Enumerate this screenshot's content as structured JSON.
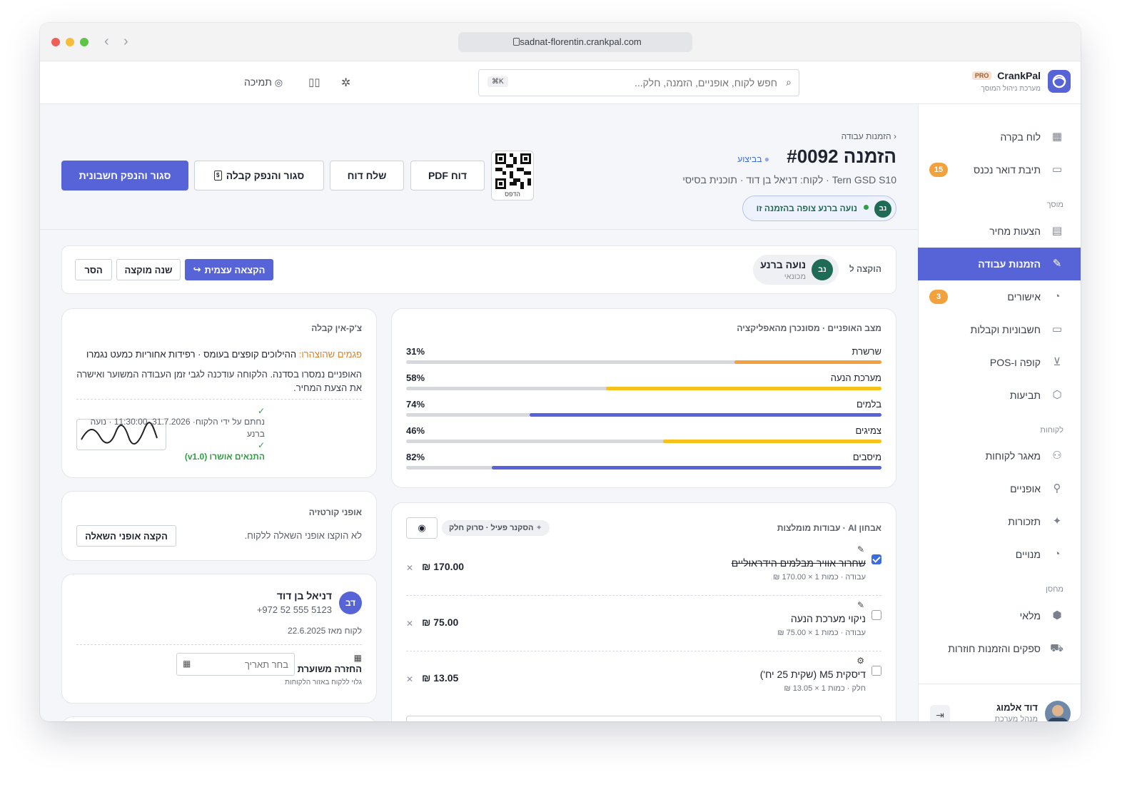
{
  "browser": {
    "url": "sadnat-florentin.crankpal.com"
  },
  "colors": {
    "accent": "#5664d8",
    "orange": "#f2a23d",
    "yellow": "#f5c11a",
    "green": "#2f9e44",
    "avatar_green": "#1f6b55"
  },
  "topbar": {
    "search_placeholder": "חפש לקוח, אופניים, הזמנה, חלק...",
    "search_shortcut": "⌘K",
    "support_label": "תמיכה"
  },
  "brand": {
    "name": "CrankPal",
    "tag": "PRO",
    "subtitle": "מערכת ניהול המוסך"
  },
  "sidebar": {
    "items": [
      {
        "label": "לוח בקרה",
        "icon": "grid-icon"
      },
      {
        "label": "תיבת דואר נכנס",
        "icon": "inbox-icon",
        "badge": "15"
      },
      {
        "label": "הצעות מחיר",
        "icon": "document-icon"
      },
      {
        "label": "הזמנות עבודה",
        "icon": "wrench-icon"
      },
      {
        "label": "אישורים",
        "icon": "check-circle-icon",
        "badge": "3"
      },
      {
        "label": "חשבוניות וקבלות",
        "icon": "money-icon"
      },
      {
        "label": "קופה ו-POS",
        "icon": "cart-icon"
      },
      {
        "label": "תביעות",
        "icon": "shield-icon"
      },
      {
        "label": "מאגר לקוחות",
        "icon": "users-icon"
      },
      {
        "label": "אופניים",
        "icon": "bike-icon"
      },
      {
        "label": "תזכורות",
        "icon": "sparkle-icon"
      },
      {
        "label": "מנויים",
        "icon": "check-circle-icon"
      },
      {
        "label": "מלאי",
        "icon": "box-icon"
      },
      {
        "label": "ספקים והזמנות חוזרות",
        "icon": "truck-icon"
      }
    ],
    "sections": [
      "מוסך",
      "לקוחות",
      "מחסן"
    ],
    "user": {
      "name": "דוד אלמוג",
      "role": "מנהל מערכת"
    }
  },
  "header": {
    "breadcrumb": "הזמנות עבודה",
    "title": "הזמנה #0092",
    "status": "בביצוע",
    "subtitle": "Tern GSD S10 · לקוח: דניאל בן דוד · תוכנית בסיסי",
    "presence_initials": "נב",
    "presence_text": "נועה ברנע צופה בהזמנה זו",
    "qr_label": "הדפס",
    "buttons": {
      "pdf": "דוח PDF",
      "send_report": "שלח דוח",
      "close_receipt": "סגור והנפק קבלה",
      "close_invoice": "סגור והנפק חשבונית"
    }
  },
  "assignment": {
    "label": "הוקצה ל",
    "initials": "נב",
    "name": "נועה ברנע",
    "role": "מכונאי",
    "self_assign": "הקצאה עצמית",
    "change": "שנה מוקצה",
    "remove": "הסר"
  },
  "bike_status": {
    "title": "מצב האופניים · מסונכרן מהאפליקציה",
    "rows": [
      {
        "label": "שרשרת",
        "pct": "31%",
        "value": 31,
        "color": "#f2a23d"
      },
      {
        "label": "מערכת הנעה",
        "pct": "58%",
        "value": 58,
        "color": "#f5c11a"
      },
      {
        "label": "בלמים",
        "pct": "74%",
        "value": 74,
        "color": "#5664d8"
      },
      {
        "label": "צמיגים",
        "pct": "46%",
        "value": 46,
        "color": "#f5c11a"
      },
      {
        "label": "מיסבים",
        "pct": "82%",
        "value": 82,
        "color": "#5664d8"
      }
    ]
  },
  "checkin": {
    "title": "צ'ק-אין קבלה",
    "defects_label": "פגמים שהוצהרו:",
    "defects_text": "ההילוכים קופצים בעומס · רפידות אחוריות כמעט נגמרו",
    "notes": "האופניים נמסרו בסדנה. הלקוחה עודכנה לגבי זמן העבודה המשוער ואישרה את הצעת המחיר.",
    "signed_text": "נחתם על ידי הלקוח· 31.7.2026, 11:30:00 · נועה ברנע",
    "terms_text": "התנאים אושרו (v1.0)"
  },
  "courtesy": {
    "title": "אופני קורטזיה",
    "text": "לא הוקצו אופני השאלה ללקוח.",
    "button": "הקצה אופני השאלה"
  },
  "customer": {
    "initials": "דב",
    "name": "דניאל בן דוד",
    "phone": "+972 52 555 5123",
    "since": "לקוח מאז 22.6.2025",
    "return_label": "החזרה משוערת",
    "return_note": "גלוי ללקוח באזור הלקוחות",
    "date_placeholder": "בחר תאריך"
  },
  "ai_jobs": {
    "title": "אבחון AI · עבודות מומלצות",
    "scanner_chip": "הסקנר פעיל · סרוק חלק",
    "rows": [
      {
        "title": "שחרור אוויר מבלמים הידראוליים",
        "sub": "עבודה · כמות 1 × 170.00 ₪",
        "price": "170.00 ₪",
        "checked": true,
        "icon": "wrench-icon"
      },
      {
        "title": "ניקוי מערכת הנעה",
        "sub": "עבודה · כמות 1 × 75.00 ₪",
        "price": "75.00 ₪",
        "checked": false,
        "icon": "wrench-icon"
      },
      {
        "title": "דיסקית M5 (שקית 25 יח')",
        "sub": "חלק · כמות 1 × 13.05 ₪",
        "price": "13.05 ₪",
        "checked": false,
        "icon": "gear-icon"
      }
    ]
  }
}
